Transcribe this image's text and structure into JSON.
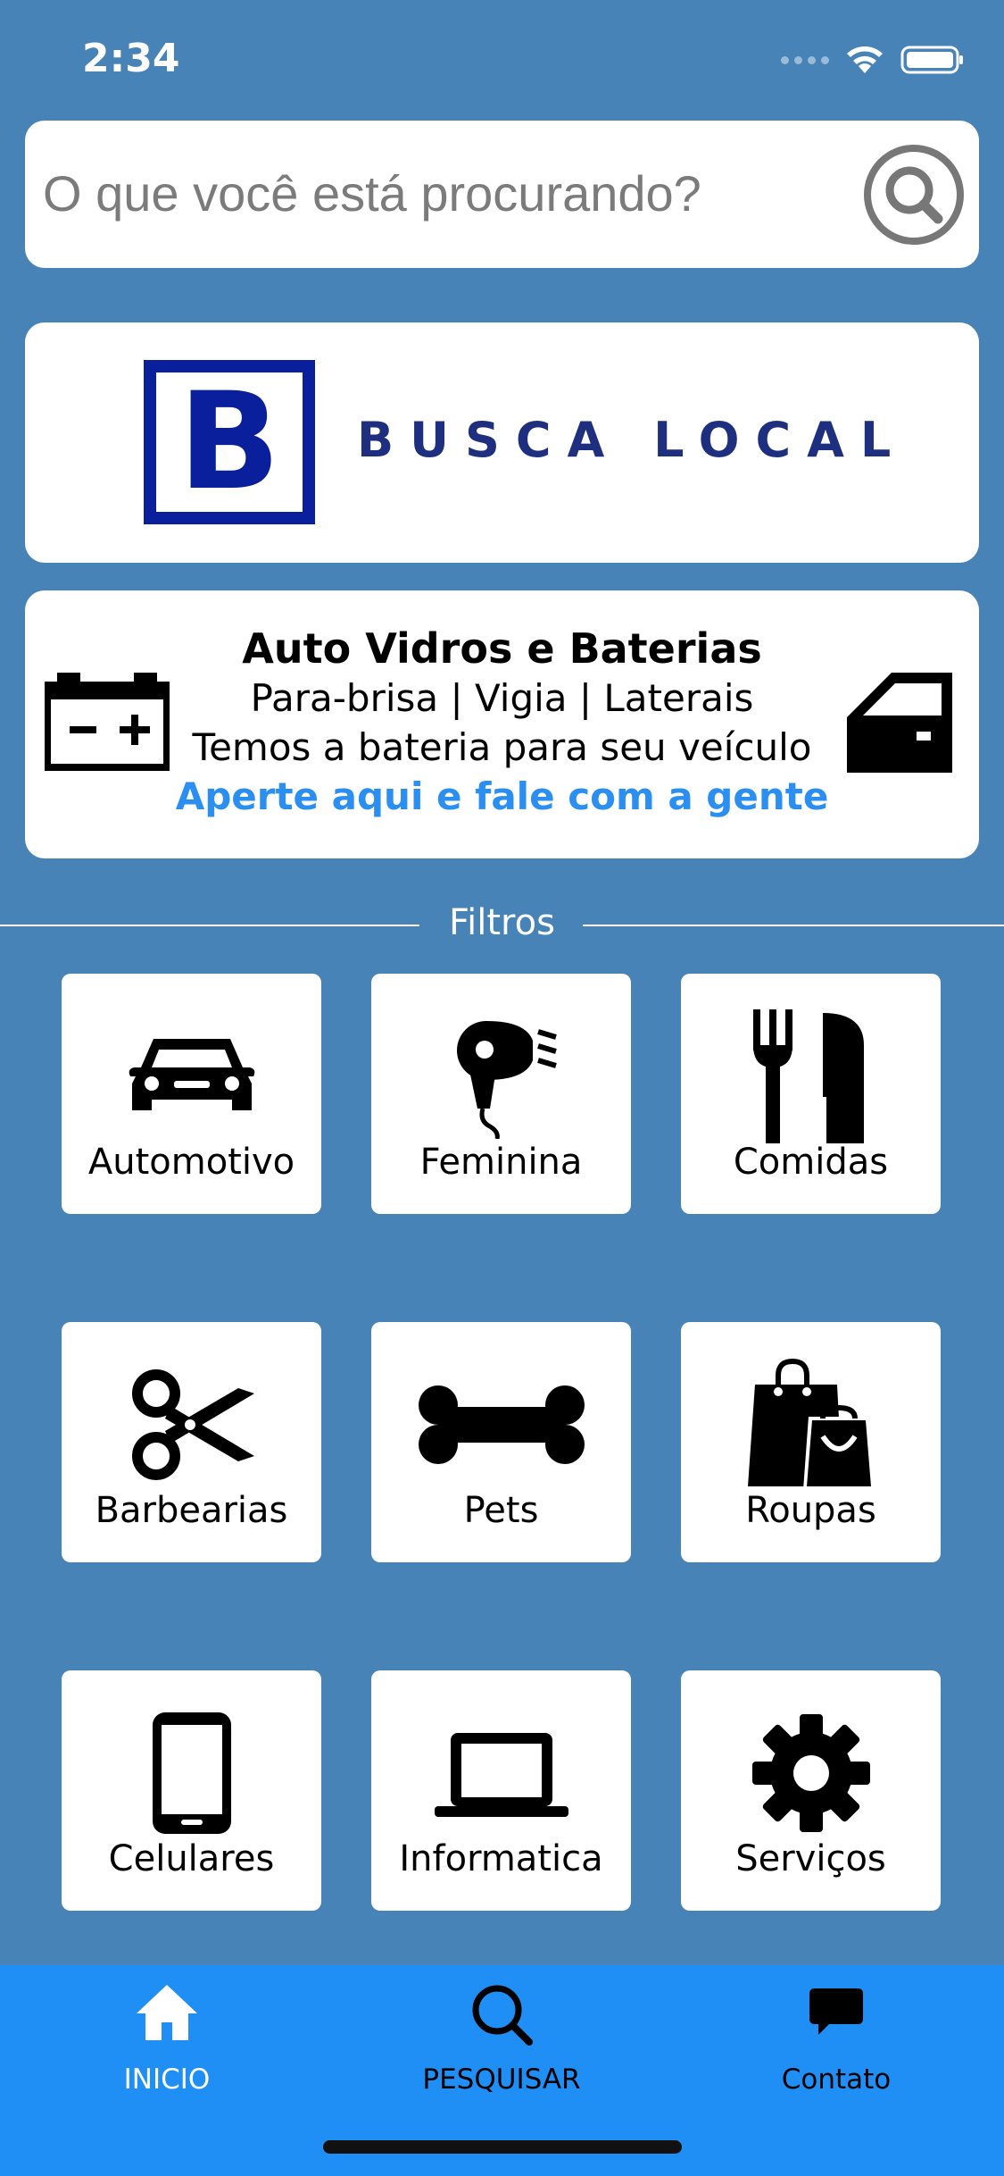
{
  "status_bar": {
    "time": "2:34"
  },
  "search": {
    "placeholder": "O que você está procurando?"
  },
  "logo": {
    "letter": "B",
    "text": "BUSCA LOCAL"
  },
  "ad": {
    "title": "Auto Vidros e Baterias",
    "line1": "Para-brisa | Vigia | Laterais",
    "line2": "Temos a bateria para seu veículo",
    "cta": "Aperte aqui e fale com a gente"
  },
  "filters": {
    "label": "Filtros",
    "items": [
      {
        "label": "Automotivo",
        "icon": "car-icon"
      },
      {
        "label": "Feminina",
        "icon": "hair-dryer-icon"
      },
      {
        "label": "Comidas",
        "icon": "utensils-icon"
      },
      {
        "label": "Barbearias",
        "icon": "scissors-icon"
      },
      {
        "label": "Pets",
        "icon": "bone-icon"
      },
      {
        "label": "Roupas",
        "icon": "shopping-bag-icon"
      },
      {
        "label": "Celulares",
        "icon": "mobile-phone-icon"
      },
      {
        "label": "Informatica",
        "icon": "laptop-icon"
      },
      {
        "label": "Serviços",
        "icon": "gear-icon"
      }
    ]
  },
  "tab_bar": {
    "tabs": [
      {
        "label": "INICIO",
        "icon": "home-icon",
        "active": true
      },
      {
        "label": "PESQUISAR",
        "icon": "search-icon",
        "active": false
      },
      {
        "label": "Contato",
        "icon": "chat-icon",
        "active": false
      }
    ]
  },
  "colors": {
    "background": "#4783b6",
    "tab_bar": "#1f8ff5",
    "logo_blue": "#0a1f9c",
    "cta_blue": "#2a8ff0",
    "active_tab_text": "#ffffff",
    "inactive_tab_text": "#000000"
  }
}
